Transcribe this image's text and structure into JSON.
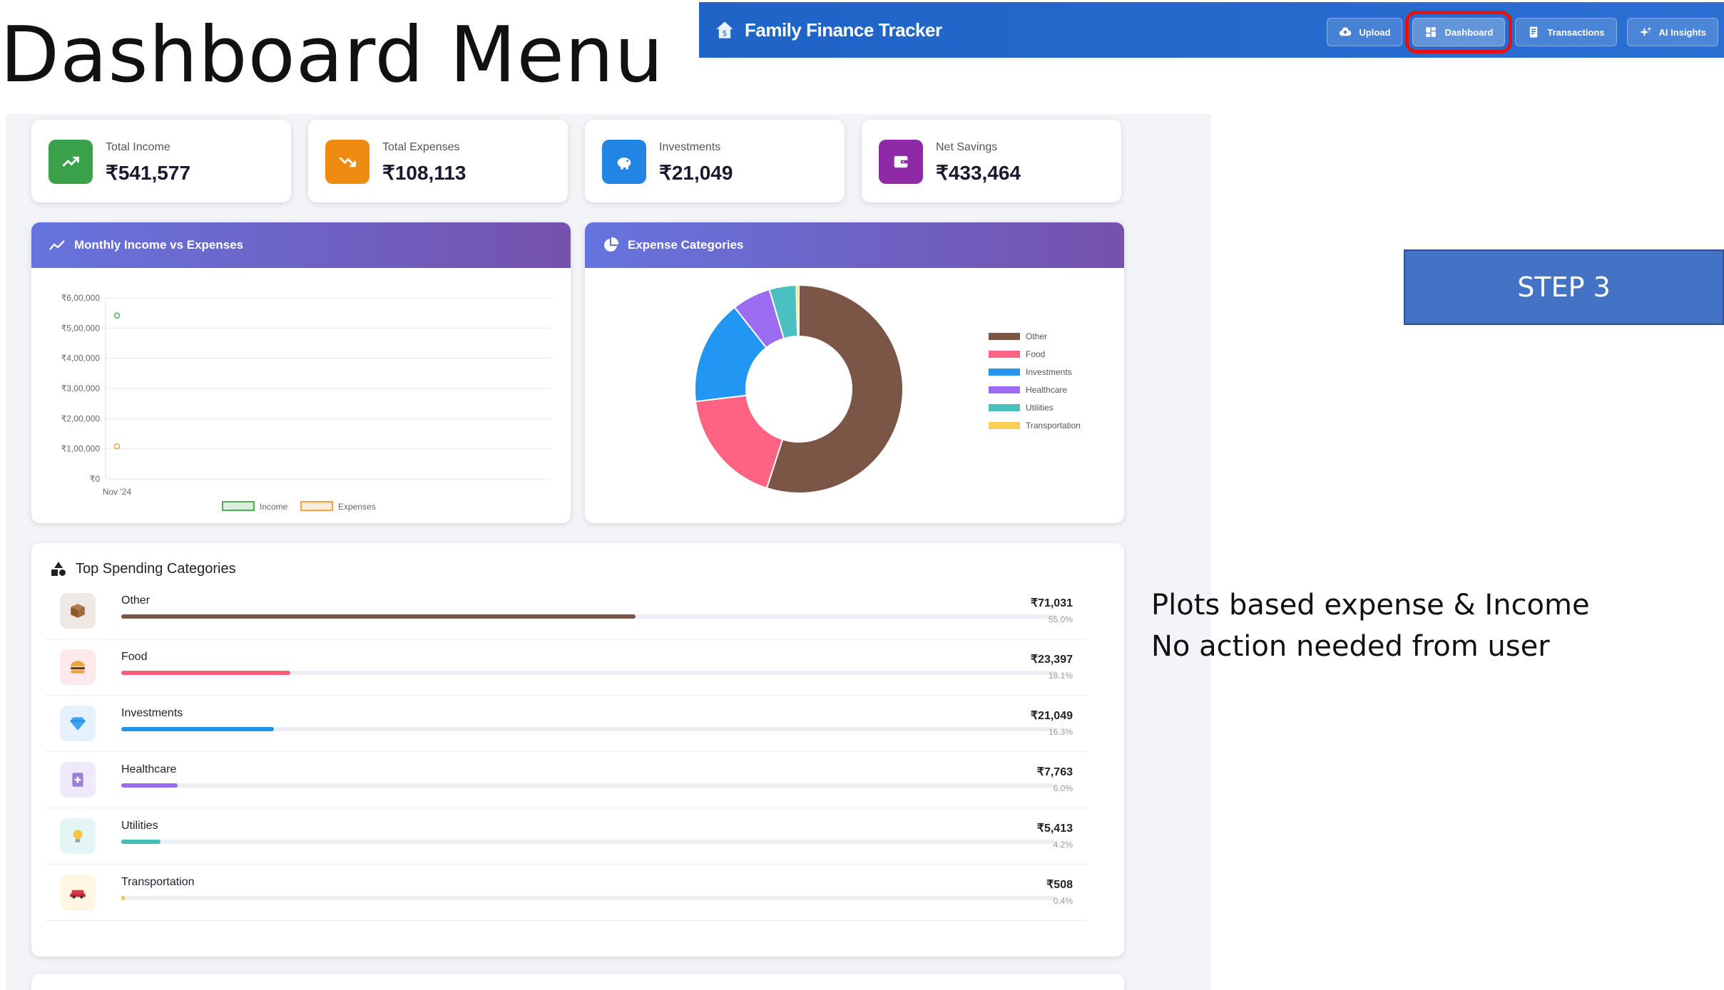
{
  "slide": {
    "title": "Dashboard Menu",
    "step_label": "STEP 3",
    "note_line1": "Plots based expense & Income",
    "note_line2": "No action needed from user"
  },
  "navbar": {
    "app_title": "Family Finance Tracker",
    "buttons": [
      {
        "label": "Upload",
        "icon": "cloud-upload-icon"
      },
      {
        "label": "Dashboard",
        "icon": "dashboard-grid-icon",
        "active": true
      },
      {
        "label": "Transactions",
        "icon": "receipt-icon"
      },
      {
        "label": "AI Insights",
        "icon": "sparkle-icon"
      }
    ],
    "highlight_color": "#e01414"
  },
  "stats": [
    {
      "label": "Total Income",
      "value": "₹541,577",
      "color": "#3aa14a",
      "icon": "trend-up-icon"
    },
    {
      "label": "Total Expenses",
      "value": "₹108,113",
      "color": "#f08b12",
      "icon": "trend-down-icon"
    },
    {
      "label": "Investments",
      "value": "₹21,049",
      "color": "#2285e3",
      "icon": "piggy-bank-icon"
    },
    {
      "label": "Net Savings",
      "value": "₹433,464",
      "color": "#8e2aa6",
      "icon": "wallet-icon"
    }
  ],
  "line_panel": {
    "title": "Monthly Income vs Expenses"
  },
  "pie_panel": {
    "title": "Expense Categories"
  },
  "top_spending": {
    "title": "Top Spending Categories",
    "rows": [
      {
        "name": "Other",
        "amount": "₹71,031",
        "pct": "55.0%",
        "fraction": 0.55,
        "color": "#7b5545",
        "bg": "#efe9e6",
        "icon": "box-icon"
      },
      {
        "name": "Food",
        "amount": "₹23,397",
        "pct": "18.1%",
        "fraction": 0.181,
        "color": "#f6607a",
        "bg": "#fde9ec",
        "icon": "burger-icon"
      },
      {
        "name": "Investments",
        "amount": "₹21,049",
        "pct": "16.3%",
        "fraction": 0.163,
        "color": "#2094ea",
        "bg": "#e5f1fc",
        "icon": "diamond-icon"
      },
      {
        "name": "Healthcare",
        "amount": "₹7,763",
        "pct": "6.0%",
        "fraction": 0.06,
        "color": "#9b6bf0",
        "bg": "#efe9fc",
        "icon": "medical-icon"
      },
      {
        "name": "Utilities",
        "amount": "₹5,413",
        "pct": "4.2%",
        "fraction": 0.042,
        "color": "#47bcb8",
        "bg": "#e3f5f4",
        "icon": "bulb-icon"
      },
      {
        "name": "Transportation",
        "amount": "₹508",
        "pct": "0.4%",
        "fraction": 0.004,
        "color": "#f7c547",
        "bg": "#fdf6e3",
        "icon": "car-icon"
      }
    ]
  },
  "chart_data": [
    {
      "type": "line",
      "title": "Monthly Income vs Expenses",
      "x": [
        "Nov '24"
      ],
      "y_ticks": [
        "₹0",
        "₹1,00,000",
        "₹2,00,000",
        "₹3,00,000",
        "₹4,00,000",
        "₹5,00,000",
        "₹6,00,000"
      ],
      "ylim": [
        0,
        600000
      ],
      "series": [
        {
          "name": "Income",
          "values": [
            541577
          ],
          "color": "#4caf50"
        },
        {
          "name": "Expenses",
          "values": [
            108113
          ],
          "color": "#ff9f40"
        }
      ],
      "grid": true,
      "legend": "bottom"
    },
    {
      "type": "pie",
      "title": "Expense Categories",
      "labels": [
        "Other",
        "Food",
        "Investments",
        "Healthcare",
        "Utilities",
        "Transportation"
      ],
      "values": [
        71031,
        23397,
        21049,
        7763,
        5413,
        508
      ],
      "colors": [
        "#7b5545",
        "#ff6384",
        "#2196f3",
        "#9b6bf0",
        "#4bc0c0",
        "#ffce56"
      ],
      "donut": true,
      "legend": "right"
    }
  ]
}
